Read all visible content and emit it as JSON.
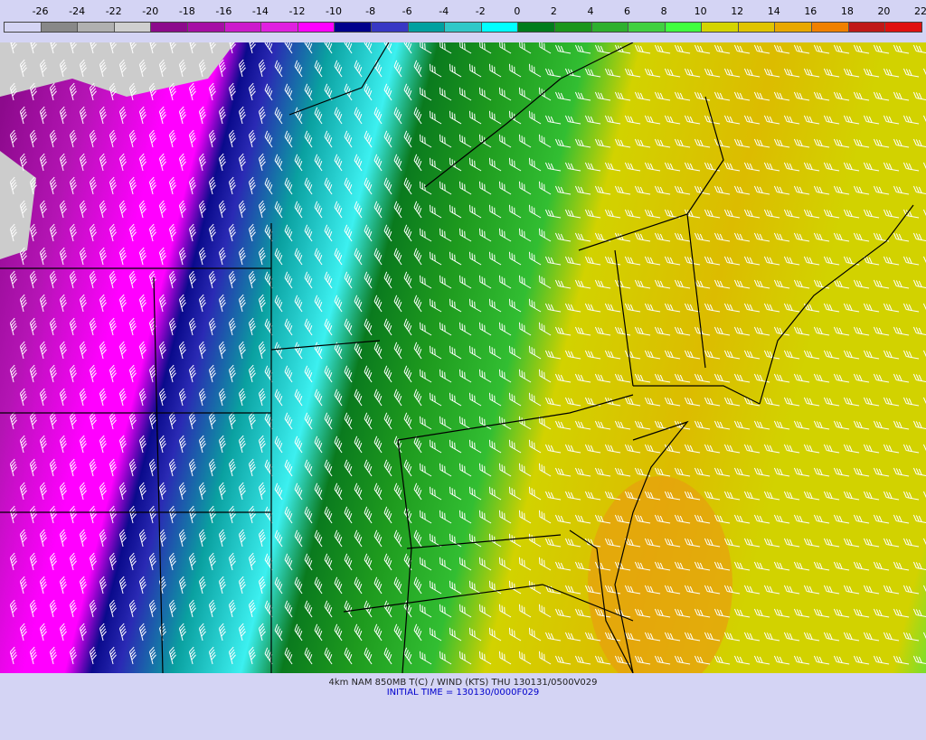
{
  "legend": {
    "ticks": [
      "-26",
      "-24",
      "-22",
      "-20",
      "-18",
      "-16",
      "-14",
      "-12",
      "-10",
      "-8",
      "-6",
      "-4",
      "-2",
      "0",
      "2",
      "4",
      "6",
      "8",
      "10",
      "12",
      "14",
      "16",
      "18",
      "20",
      "22"
    ],
    "colors": [
      "#d4d4f4",
      "#888888",
      "#b0b0b0",
      "#cfcfcf",
      "#8c0a8c",
      "#a50ea5",
      "#cc1acc",
      "#e020e0",
      "#ff00ff",
      "#00008c",
      "#3838c4",
      "#00a0a0",
      "#30c8c8",
      "#00ffff",
      "#007c1c",
      "#1c961c",
      "#2eb02e",
      "#40d040",
      "#40ff40",
      "#d4d400",
      "#e0c400",
      "#e8a800",
      "#f08000",
      "#c01818",
      "#e01010"
    ]
  },
  "map": {
    "temperature_bands_colors": {
      "deep_purple": "#8c0a8c",
      "purple": "#b414b4",
      "magenta": "#ff00ff",
      "navy": "#0a0a8c",
      "blue": "#2a2ab4",
      "teal": "#0aa0a0",
      "cyan": "#3cf0f0",
      "dark_green": "#0a7a1e",
      "green": "#1e9a1e",
      "mid_green": "#32be32",
      "light_green": "#46e646",
      "yellow": "#d2d200",
      "gold": "#dcbc00",
      "orange": "#e89e10",
      "snow_gray": "#cccccc"
    },
    "barb_color": "#ffffff",
    "border_color": "#000000"
  },
  "caption": {
    "line1": "4km NAM 850MB T(C) / WIND (KTS) THU 130131/0500V029",
    "line2": "INITIAL TIME = 130130/0000F029"
  }
}
